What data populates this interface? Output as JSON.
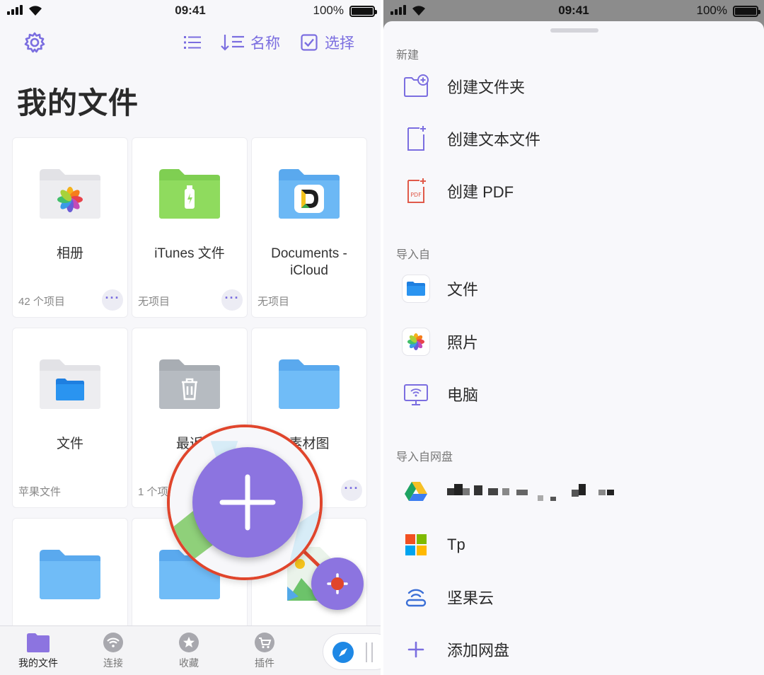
{
  "status_left": {
    "time": "09:41",
    "battery": "100%"
  },
  "status_right": {
    "time": "09:41",
    "battery": "100%"
  },
  "toolbar": {
    "sort_label": "名称",
    "select_label": "选择"
  },
  "page_title": "我的文件",
  "tiles": [
    {
      "name": "相册",
      "meta": "42 个项目",
      "icon": "photos-folder-icon"
    },
    {
      "name": "iTunes 文件",
      "meta": "无项目",
      "icon": "usb-folder-icon"
    },
    {
      "name": "Documents -\niCloud",
      "meta": "无项目",
      "icon": "documents-folder-icon"
    },
    {
      "name": "文件",
      "meta": "苹果文件",
      "icon": "files-folder-icon"
    },
    {
      "name": "最近",
      "meta": "1 个项",
      "icon": "trash-folder-icon"
    },
    {
      "name": "素材图",
      "meta": "",
      "icon": "folder-icon"
    }
  ],
  "tabbar": [
    {
      "label": "我的文件",
      "icon": "folder-icon",
      "active": true
    },
    {
      "label": "连接",
      "icon": "wifi-icon",
      "active": false
    },
    {
      "label": "收藏",
      "icon": "star-icon",
      "active": false
    },
    {
      "label": "插件",
      "icon": "cart-icon",
      "active": false
    }
  ],
  "sheet": {
    "section_new": "新建",
    "new_items": [
      {
        "label": "创建文件夹",
        "icon": "new-folder-icon"
      },
      {
        "label": "创建文本文件",
        "icon": "new-text-file-icon"
      },
      {
        "label": "创建 PDF",
        "icon": "new-pdf-icon"
      }
    ],
    "section_import": "导入自",
    "import_items": [
      {
        "label": "文件",
        "icon": "files-app-icon"
      },
      {
        "label": "照片",
        "icon": "photos-app-icon"
      },
      {
        "label": "电脑",
        "icon": "computer-icon"
      }
    ],
    "section_cloud": "导入自网盘",
    "cloud_items": [
      {
        "label": "",
        "icon": "google-drive-icon"
      },
      {
        "label": "Tp",
        "icon": "onedrive-windows-icon"
      },
      {
        "label": "坚果云",
        "icon": "jianguoyun-icon"
      },
      {
        "label": "添加网盘",
        "icon": "add-icon"
      }
    ]
  },
  "colors": {
    "accent": "#7b6ee0",
    "fab": "#8c74e0",
    "callout": "#e0452c"
  }
}
